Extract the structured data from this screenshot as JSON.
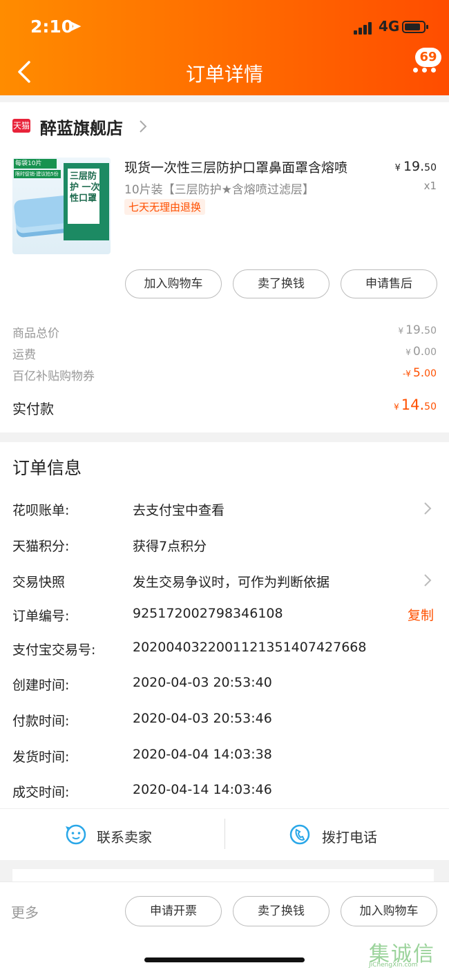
{
  "status_bar": {
    "time": "2:10",
    "network": "4G"
  },
  "header": {
    "title": "订单详情",
    "badge_count": "69"
  },
  "shop": {
    "logo_text": "天猫",
    "name": "醉蓝旗舰店"
  },
  "product": {
    "title": "现货一次性三层防护口罩鼻面罩含熔喷",
    "spec": "10片装【三层防护★含熔喷过滤层】",
    "tag": "七天无理由退换",
    "price_currency": "¥",
    "price_int": "19.",
    "price_dec": "50",
    "quantity": "x1",
    "thumb": {
      "tag1": "每袋10片",
      "tag2": "限时促销·建议拍5份",
      "pkg_text": "三层防护 一次性口罩"
    }
  },
  "product_actions": {
    "add_cart": "加入购物车",
    "sell": "卖了换钱",
    "after_sale": "申请售后"
  },
  "costs": {
    "items": [
      {
        "label": "商品总价",
        "currency": "¥",
        "int": "19.",
        "dec": "50"
      },
      {
        "label": "运费",
        "currency": "¥",
        "int": "0.",
        "dec": "00"
      },
      {
        "label": "百亿补贴购物券",
        "currency": "-¥",
        "int": "5.",
        "dec": "00"
      }
    ],
    "paid": {
      "label": "实付款",
      "currency": "¥",
      "int": "14.",
      "dec": "50"
    }
  },
  "order_info": {
    "title": "订单信息",
    "rows": [
      {
        "label": "花呗账单:",
        "value": "去支付宝中查看"
      },
      {
        "label": "天猫积分:",
        "value": "获得7点积分"
      },
      {
        "label": "交易快照",
        "value": "发生交易争议时，可作为判断依据"
      },
      {
        "label": "订单编号:",
        "value": "925172002798346108"
      },
      {
        "label": "支付宝交易号:",
        "value": "2020040322001121351407427668"
      },
      {
        "label": "创建时间:",
        "value": "2020-04-03 20:53:40"
      },
      {
        "label": "付款时间:",
        "value": "2020-04-03 20:53:46"
      },
      {
        "label": "发货时间:",
        "value": "2020-04-04 14:03:38"
      },
      {
        "label": "成交时间:",
        "value": "2020-04-14 14:03:46"
      }
    ],
    "copy_label": "复制"
  },
  "contact": {
    "seller": "联系卖家",
    "phone": "拨打电话"
  },
  "bottom_bar": {
    "more": "更多",
    "invoice": "申请开票",
    "sell": "卖了换钱",
    "add_cart": "加入购物车"
  },
  "watermark": {
    "text": "集诚信",
    "url_text": "JiChengXin.com"
  },
  "colors": {
    "accent": "#ff5000",
    "header_start": "#ff8c00",
    "header_end": "#ff4d00"
  }
}
